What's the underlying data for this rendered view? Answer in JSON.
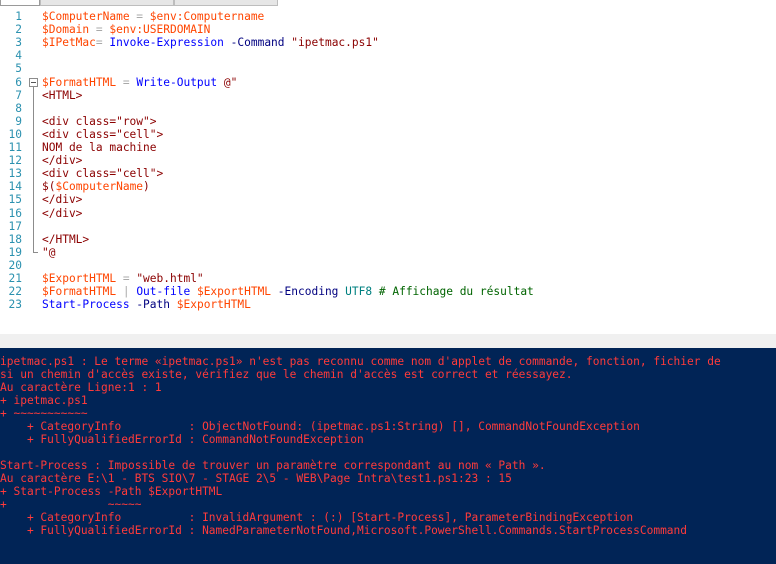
{
  "tabs": [
    {
      "label": ""
    },
    {
      "label": ""
    },
    {
      "label": ""
    }
  ],
  "editor": {
    "lines": [
      {
        "n": "1",
        "tokens": [
          {
            "c": "var",
            "t": "$ComputerName"
          },
          {
            "c": "op",
            "t": " = "
          },
          {
            "c": "var",
            "t": "$env:Computername"
          }
        ]
      },
      {
        "n": "2",
        "tokens": [
          {
            "c": "var",
            "t": "$Domain"
          },
          {
            "c": "op",
            "t": " = "
          },
          {
            "c": "var",
            "t": "$env:USERDOMAIN"
          }
        ]
      },
      {
        "n": "3",
        "tokens": [
          {
            "c": "var",
            "t": "$IPetMac"
          },
          {
            "c": "op",
            "t": "= "
          },
          {
            "c": "cmd",
            "t": "Invoke-Expression"
          },
          {
            "c": "plain",
            "t": " "
          },
          {
            "c": "param",
            "t": "-Command"
          },
          {
            "c": "plain",
            "t": " "
          },
          {
            "c": "str",
            "t": "\"ipetmac.ps1\""
          }
        ]
      },
      {
        "n": "4",
        "tokens": []
      },
      {
        "n": "5",
        "tokens": []
      },
      {
        "n": "6",
        "tokens": [
          {
            "c": "var",
            "t": "$FormatHTML"
          },
          {
            "c": "op",
            "t": " = "
          },
          {
            "c": "cmd",
            "t": "Write-Output"
          },
          {
            "c": "plain",
            "t": " "
          },
          {
            "c": "str",
            "t": "@\""
          }
        ]
      },
      {
        "n": "7",
        "tokens": [
          {
            "c": "str",
            "t": "<HTML>"
          }
        ]
      },
      {
        "n": "8",
        "tokens": []
      },
      {
        "n": "9",
        "tokens": [
          {
            "c": "str",
            "t": "<div class=\"row\">"
          }
        ]
      },
      {
        "n": "10",
        "tokens": [
          {
            "c": "str",
            "t": "<div class=\"cell\">"
          }
        ]
      },
      {
        "n": "11",
        "tokens": [
          {
            "c": "str",
            "t": "NOM de la machine"
          }
        ]
      },
      {
        "n": "12",
        "tokens": [
          {
            "c": "str",
            "t": "</div>"
          }
        ]
      },
      {
        "n": "13",
        "tokens": [
          {
            "c": "str",
            "t": "<div class=\"cell\">"
          }
        ]
      },
      {
        "n": "14",
        "tokens": [
          {
            "c": "str",
            "t": "$("
          },
          {
            "c": "var",
            "t": "$ComputerName"
          },
          {
            "c": "str",
            "t": ")"
          }
        ]
      },
      {
        "n": "15",
        "tokens": [
          {
            "c": "str",
            "t": "</div>"
          }
        ]
      },
      {
        "n": "16",
        "tokens": [
          {
            "c": "str",
            "t": "</div>"
          }
        ]
      },
      {
        "n": "17",
        "tokens": []
      },
      {
        "n": "18",
        "tokens": [
          {
            "c": "str",
            "t": "</HTML>"
          }
        ]
      },
      {
        "n": "19",
        "tokens": [
          {
            "c": "str",
            "t": "\"@"
          }
        ]
      },
      {
        "n": "20",
        "tokens": []
      },
      {
        "n": "21",
        "tokens": [
          {
            "c": "var",
            "t": "$ExportHTML"
          },
          {
            "c": "op",
            "t": " = "
          },
          {
            "c": "str",
            "t": "\"web.html\""
          }
        ]
      },
      {
        "n": "22",
        "tokens": [
          {
            "c": "var",
            "t": "$FormatHTML"
          },
          {
            "c": "op",
            "t": " | "
          },
          {
            "c": "cmd",
            "t": "Out-file"
          },
          {
            "c": "plain",
            "t": " "
          },
          {
            "c": "var",
            "t": "$ExportHTML"
          },
          {
            "c": "plain",
            "t": " "
          },
          {
            "c": "param",
            "t": "-Encoding"
          },
          {
            "c": "plain",
            "t": " "
          },
          {
            "c": "type",
            "t": "UTF8"
          },
          {
            "c": "plain",
            "t": " "
          },
          {
            "c": "cmt",
            "t": "# Affichage du résultat"
          }
        ]
      },
      {
        "n": "23",
        "tokens": [
          {
            "c": "cmd",
            "t": "Start-Process"
          },
          {
            "c": "plain",
            "t": " "
          },
          {
            "c": "param",
            "t": "-Path"
          },
          {
            "c": "plain",
            "t": " "
          },
          {
            "c": "var",
            "t": "$ExportHTML"
          }
        ]
      }
    ]
  },
  "console": {
    "lines": [
      "ipetmac.ps1 : Le terme «ipetmac.ps1» n'est pas reconnu comme nom d'applet de commande, fonction, fichier de",
      "si un chemin d'accès existe, vérifiez que le chemin d'accès est correct et réessayez.",
      "Au caractère Ligne:1 : 1",
      "+ ipetmac.ps1",
      "+ ~~~~~~~~~~~",
      "    + CategoryInfo          : ObjectNotFound: (ipetmac.ps1:String) [], CommandNotFoundException",
      "    + FullyQualifiedErrorId : CommandNotFoundException",
      "",
      "Start-Process : Impossible de trouver un paramètre correspondant au nom « Path ».",
      "Au caractère E:\\1 - BTS SIO\\7 - STAGE 2\\5 - WEB\\Page Intra\\test1.ps1:23 : 15",
      "+ Start-Process -Path $ExportHTML",
      "+               ~~~~~",
      "    + CategoryInfo          : InvalidArgument : (:) [Start-Process], ParameterBindingException",
      "    + FullyQualifiedErrorId : NamedParameterNotFound,Microsoft.PowerShell.Commands.StartProcessCommand"
    ]
  },
  "colors": {
    "editor_bg": "#ffffff",
    "console_bg": "#012456",
    "error_text": "#ff3b3b",
    "line_number": "#2b91af",
    "variable": "#ff4500",
    "command": "#0000ff",
    "parameter": "#000080",
    "string": "#8b0000"
  },
  "icons": [
    "fold-collapse-icon"
  ]
}
